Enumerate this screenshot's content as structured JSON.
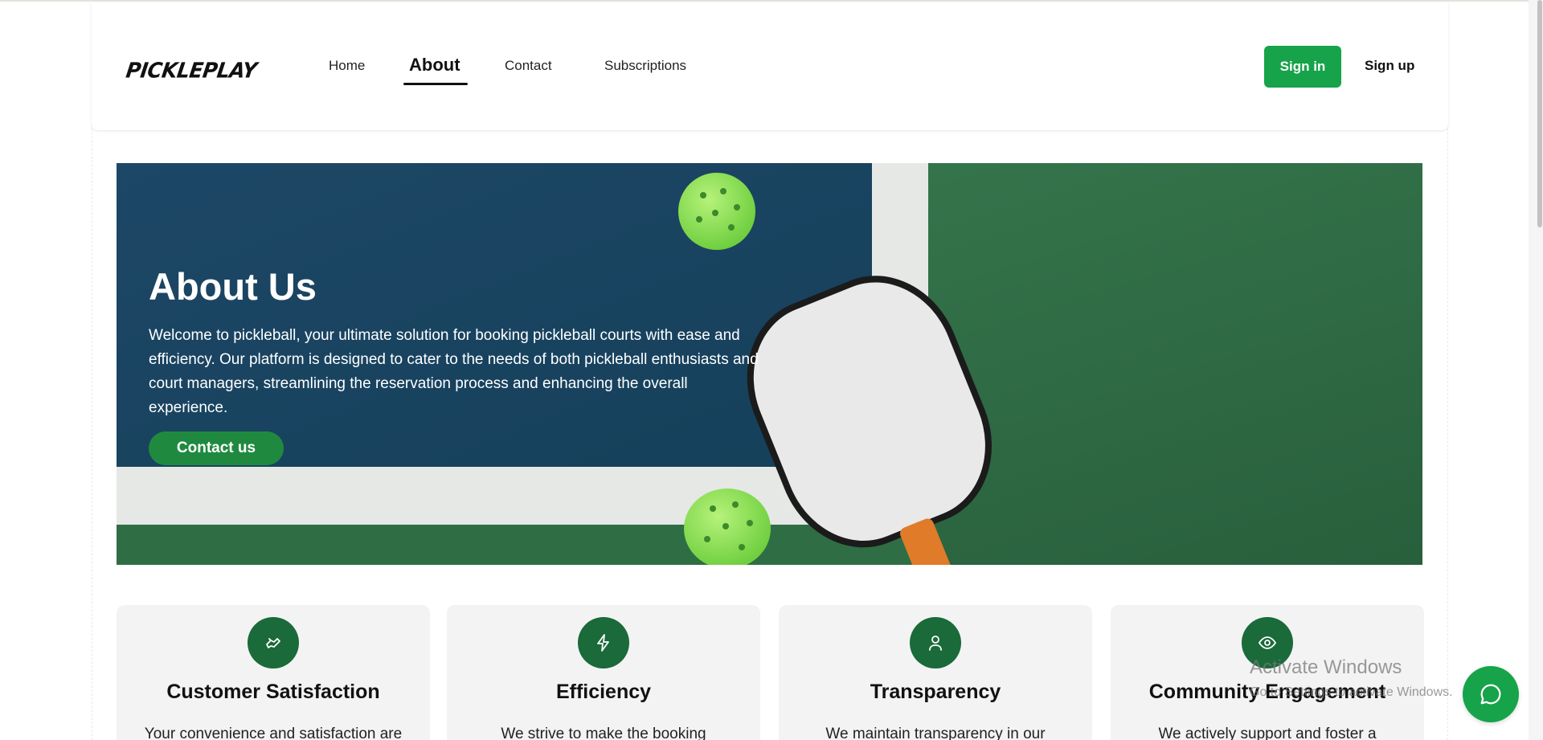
{
  "brand": {
    "logo_text": "PICKLEPLAY"
  },
  "nav": {
    "links": [
      {
        "label": "Home"
      },
      {
        "label": "About"
      },
      {
        "label": "Contact"
      },
      {
        "label": "Subscriptions"
      }
    ],
    "active": "About",
    "sign_in": "Sign in",
    "sign_up": "Sign up"
  },
  "hero": {
    "title": "About Us",
    "text": "Welcome to pickleball, your ultimate solution for booking pickleball courts with ease and efficiency. Our platform is designed to cater to the needs of both pickleball enthusiasts and court managers, streamlining the reservation process and enhancing the overall experience.",
    "button": "Contact us"
  },
  "cards": [
    {
      "icon": "handshake-icon",
      "title": "Customer Satisfaction",
      "text": "Your convenience and satisfaction are"
    },
    {
      "icon": "lightning-icon",
      "title": "Efficiency",
      "text": "We strive to make the booking"
    },
    {
      "icon": "user-icon",
      "title": "Transparency",
      "text": "We maintain transparency in our"
    },
    {
      "icon": "eye-icon",
      "title": "Community Engagement",
      "text": "We actively support and foster a"
    }
  ],
  "watermark": {
    "line1": "Activate Windows",
    "line2": "Go to Settings to activate Windows."
  },
  "colors": {
    "primary": "#17a34a",
    "icon_bg": "#1a6a3a",
    "card_bg": "#f3f3f3"
  }
}
